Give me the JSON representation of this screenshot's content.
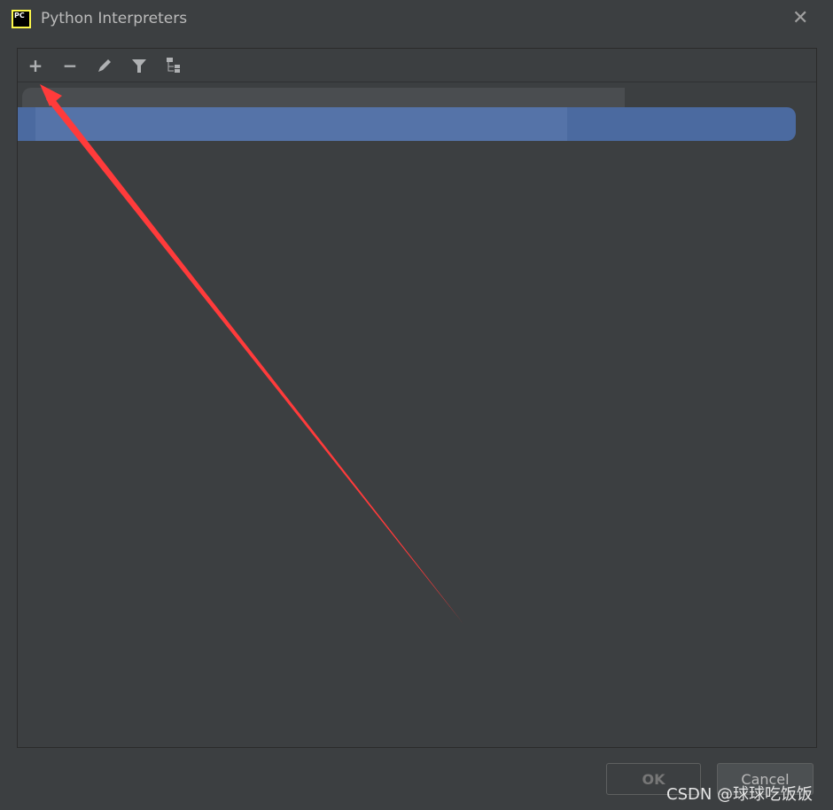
{
  "window": {
    "title": "Python Interpreters",
    "app_icon": "pycharm-logo",
    "app_icon_text": "PC"
  },
  "toolbar": {
    "icons": [
      "plus-icon",
      "minus-icon",
      "pencil-icon",
      "filter-icon",
      "tree-icon"
    ],
    "add": "+",
    "remove": "−"
  },
  "buttons": {
    "ok": "OK",
    "cancel": "Cancel"
  },
  "annotation": {
    "arrow_color": "#ff3b3b"
  },
  "watermark": "CSDN @球球吃饭饭",
  "colors": {
    "background": "#3c3f41",
    "selection": "#4b6aa0"
  }
}
